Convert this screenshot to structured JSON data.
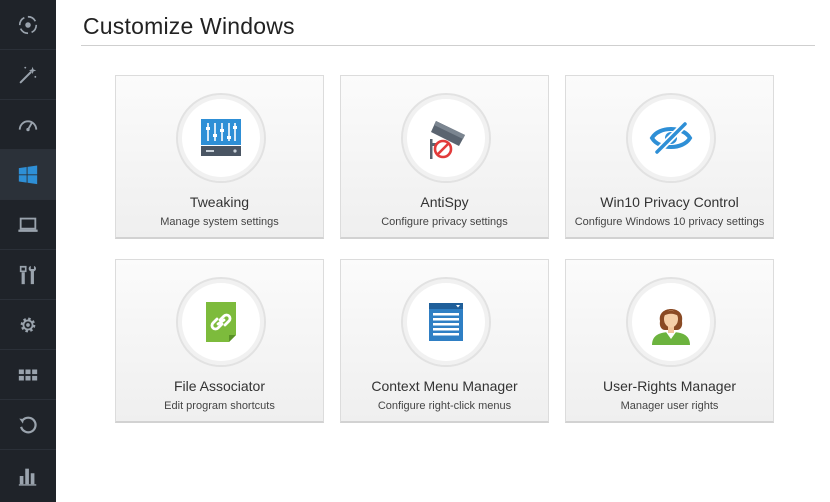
{
  "page": {
    "title": "Customize Windows"
  },
  "sidebar": {
    "items": [
      {
        "icon": "cleanup-circle-icon"
      },
      {
        "icon": "magic-wand-icon"
      },
      {
        "icon": "speedometer-icon"
      },
      {
        "icon": "windows-logo-icon",
        "active": true
      },
      {
        "icon": "laptop-icon"
      },
      {
        "icon": "tools-icon"
      },
      {
        "icon": "gear-icon"
      },
      {
        "icon": "apps-grid-icon"
      },
      {
        "icon": "restore-icon"
      },
      {
        "icon": "statistics-icon"
      }
    ]
  },
  "tiles": [
    {
      "title": "Tweaking",
      "subtitle": "Manage system settings",
      "icon": "equalizer-panel-icon"
    },
    {
      "title": "AntiSpy",
      "subtitle": "Configure privacy settings",
      "icon": "camera-blocked-icon"
    },
    {
      "title": "Win10 Privacy Control",
      "subtitle": "Configure Windows 10 privacy settings",
      "icon": "eye-hidden-icon"
    },
    {
      "title": "File Associator",
      "subtitle": "Edit program shortcuts",
      "icon": "file-link-icon"
    },
    {
      "title": "Context Menu Manager",
      "subtitle": "Configure right-click menus",
      "icon": "context-menu-icon"
    },
    {
      "title": "User-Rights Manager",
      "subtitle": "Manager user rights",
      "icon": "user-avatar-icon"
    }
  ],
  "colors": {
    "sidebar_bg": "#1f2329",
    "accent_blue": "#2e8fd6",
    "icon_grey": "#9aa3ad"
  }
}
